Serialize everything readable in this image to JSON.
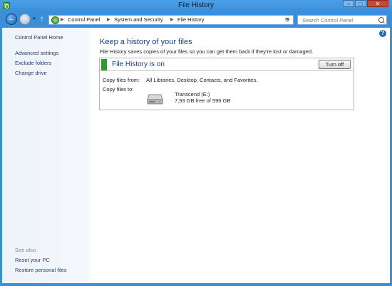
{
  "window": {
    "title": "File History",
    "minimize_glyph": "–",
    "maximize_glyph": "□",
    "close_glyph": "✕"
  },
  "nav": {
    "back_glyph": "←",
    "forward_glyph": "→",
    "up_glyph": "↑",
    "refresh_glyph": "↻",
    "breadcrumbs": [
      "Control Panel",
      "System and Security",
      "File History"
    ],
    "search_placeholder": "Search Control Panel"
  },
  "sidebar": {
    "items": [
      {
        "label": "Control Panel Home"
      },
      {
        "label": "Advanced settings"
      },
      {
        "label": "Exclude folders"
      },
      {
        "label": "Change drive"
      }
    ],
    "see_also_label": "See also",
    "see_also": [
      {
        "label": "Reset your PC"
      },
      {
        "label": "Restore personal files"
      }
    ]
  },
  "main": {
    "heading": "Keep a history of your files",
    "description": "File History saves copies of your files so you can get them back if they're lost or damaged.",
    "status": {
      "text": "File History is on",
      "status_color": "#2f9a2f",
      "button_label": "Turn off"
    },
    "copy_from_label": "Copy files from:",
    "copy_from_value": "All Libraries, Desktop, Contacts, and Favorites.",
    "copy_to_label": "Copy files to:",
    "drive": {
      "icon": "hard-drive-icon",
      "name": "Transcend (E:)",
      "free_space": "7,93 GB free of 596 GB"
    }
  },
  "colors": {
    "frame": "#3a8fd8",
    "heading": "#1a3e7a",
    "sidebar_link": "#1e3f6e"
  }
}
